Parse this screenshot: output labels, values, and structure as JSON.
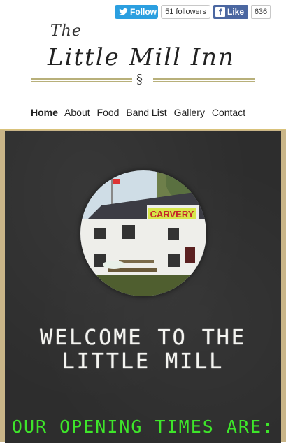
{
  "social": {
    "twitter_label": "Follow",
    "twitter_count": "51 followers",
    "facebook_label": "Like",
    "facebook_count": "636",
    "twitter_icon": "twitter-bird-icon",
    "facebook_icon": "facebook-f-icon"
  },
  "logo": {
    "the": "The",
    "name": "Little Mill Inn",
    "ornament": "§"
  },
  "nav": {
    "items": [
      {
        "label": "Home",
        "active": true
      },
      {
        "label": "About"
      },
      {
        "label": "Food"
      },
      {
        "label": "Band List"
      },
      {
        "label": "Gallery"
      },
      {
        "label": "Contact"
      }
    ]
  },
  "main": {
    "photo_sign": "CARVERY",
    "welcome_line1": "Welcome to the",
    "welcome_line2": "Little Mill",
    "opening": "Our opening times are:"
  },
  "colors": {
    "twitter": "#2b9fe0",
    "facebook": "#4b67a1",
    "board": "#2d2d2d",
    "chalk_green": "#3ee62a",
    "frame": "#c9b588"
  }
}
